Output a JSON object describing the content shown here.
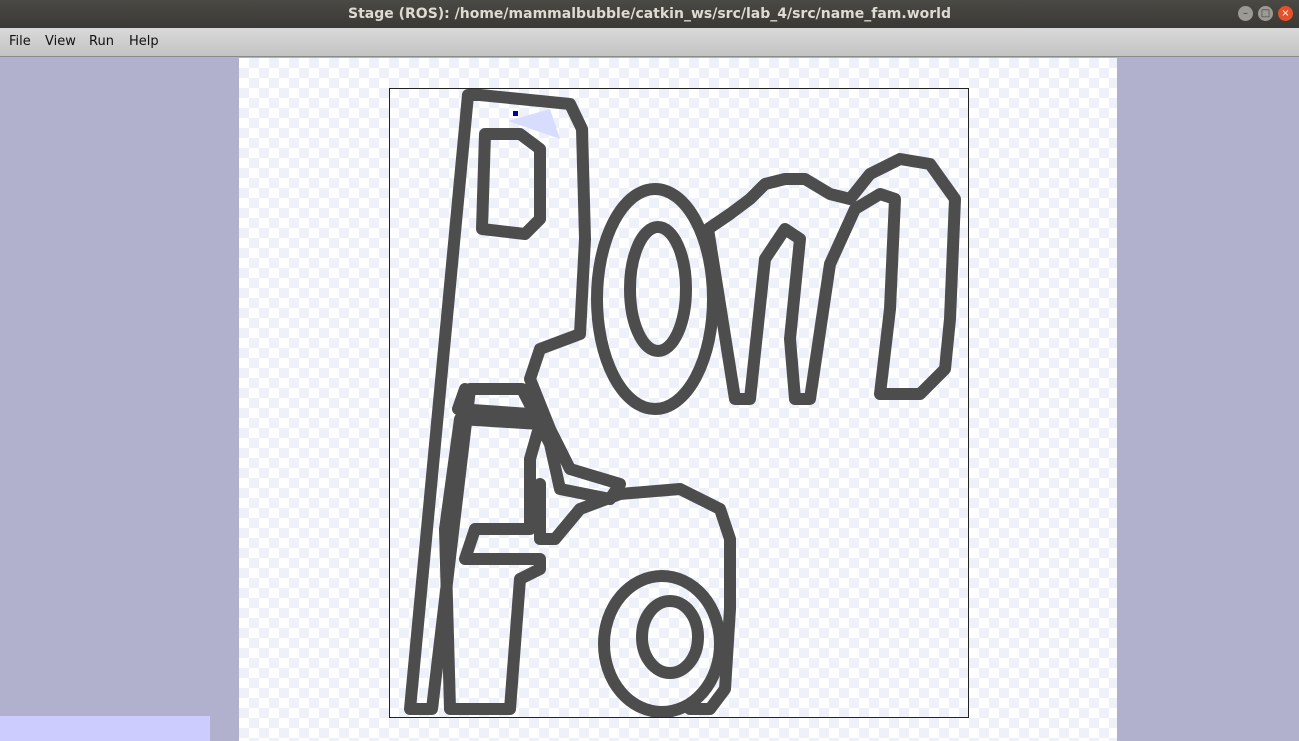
{
  "window": {
    "title": "Stage (ROS): /home/mammalbubble/catkin_ws/src/lab_4/src/name_fam.world"
  },
  "controls": {
    "minimize_icon": "–",
    "maximize_icon": "□",
    "close_icon": "×"
  },
  "menu": {
    "file": "File",
    "view": "View",
    "run": "Run",
    "help": "Help"
  },
  "map": {
    "letters": [
      "R",
      "o",
      "m",
      "F",
      "r",
      "a"
    ],
    "wall_color": "#4d4d4d",
    "robot_color": "#0000aa",
    "sensor_color": "#d8dcff"
  }
}
